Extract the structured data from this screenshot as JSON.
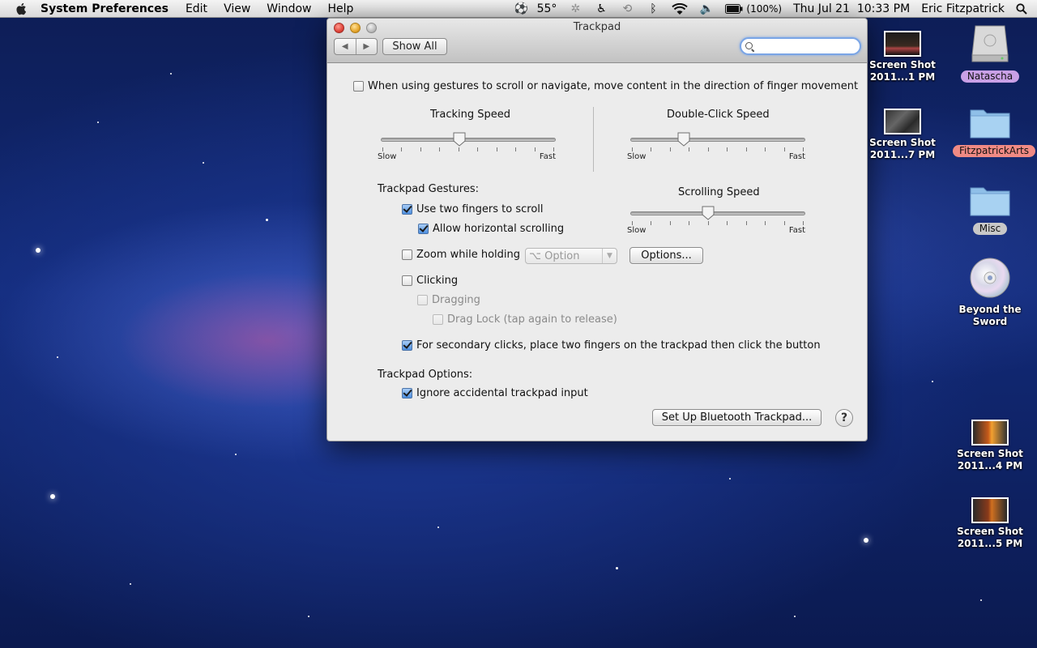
{
  "menubar": {
    "app_name": "System Preferences",
    "menus": [
      "Edit",
      "View",
      "Window",
      "Help"
    ],
    "status": {
      "temperature": "55°",
      "battery": "(100%)",
      "datetime": "Thu Jul 21  10:33 PM",
      "user": "Eric Fitzpatrick"
    }
  },
  "window": {
    "title": "Trackpad",
    "toolbar": {
      "back_label": "◀",
      "forward_label": "▶",
      "show_all_label": "Show All",
      "search_value": "",
      "search_placeholder": ""
    },
    "scroll_direction": {
      "label": "When using gestures to scroll or navigate, move content in the direction of finger movement",
      "checked": false
    },
    "tracking_speed": {
      "title": "Tracking Speed",
      "slow": "Slow",
      "fast": "Fast",
      "value": 0.45
    },
    "double_click_speed": {
      "title": "Double-Click Speed",
      "slow": "Slow",
      "fast": "Fast",
      "value": 0.3
    },
    "gestures": {
      "heading": "Trackpad Gestures:",
      "two_finger_scroll": {
        "label": "Use two fingers to scroll",
        "checked": true
      },
      "horizontal_scroll": {
        "label": "Allow horizontal scrolling",
        "checked": true
      },
      "zoom": {
        "label": "Zoom while holding",
        "checked": false,
        "modifier": "⌥ Option"
      },
      "options_button": "Options...",
      "clicking": {
        "label": "Clicking",
        "checked": false
      },
      "dragging": {
        "label": "Dragging",
        "checked": false
      },
      "drag_lock": {
        "label": "Drag Lock (tap again to release)",
        "checked": false
      },
      "secondary_click": {
        "label": "For secondary clicks, place two fingers on the trackpad then click the button",
        "checked": true
      }
    },
    "scrolling_speed": {
      "title": "Scrolling Speed",
      "slow": "Slow",
      "fast": "Fast",
      "value": 0.45
    },
    "options": {
      "heading": "Trackpad Options:",
      "ignore_accidental": {
        "label": "Ignore accidental trackpad input",
        "checked": true
      }
    },
    "setup_button": "Set Up Bluetooth Trackpad...",
    "help_label": "?"
  },
  "desktop": {
    "icons": [
      {
        "line1": "Screen Shot",
        "line2": "2011...1 PM"
      },
      {
        "line1": "Natascha",
        "tag_color": "#c9a0e6"
      },
      {
        "line1": "Screen Shot",
        "line2": "2011...7 PM"
      },
      {
        "line1": "FitzpatrickArts",
        "tag_color": "#f08a84"
      },
      {
        "line1": "Misc",
        "tag_color": "#c8c8c8"
      },
      {
        "line1": "Beyond the",
        "line2": "Sword"
      },
      {
        "line1": "Screen Shot",
        "line2": "2011...4 PM"
      },
      {
        "line1": "Screen Shot",
        "line2": "2011...5 PM"
      }
    ]
  }
}
